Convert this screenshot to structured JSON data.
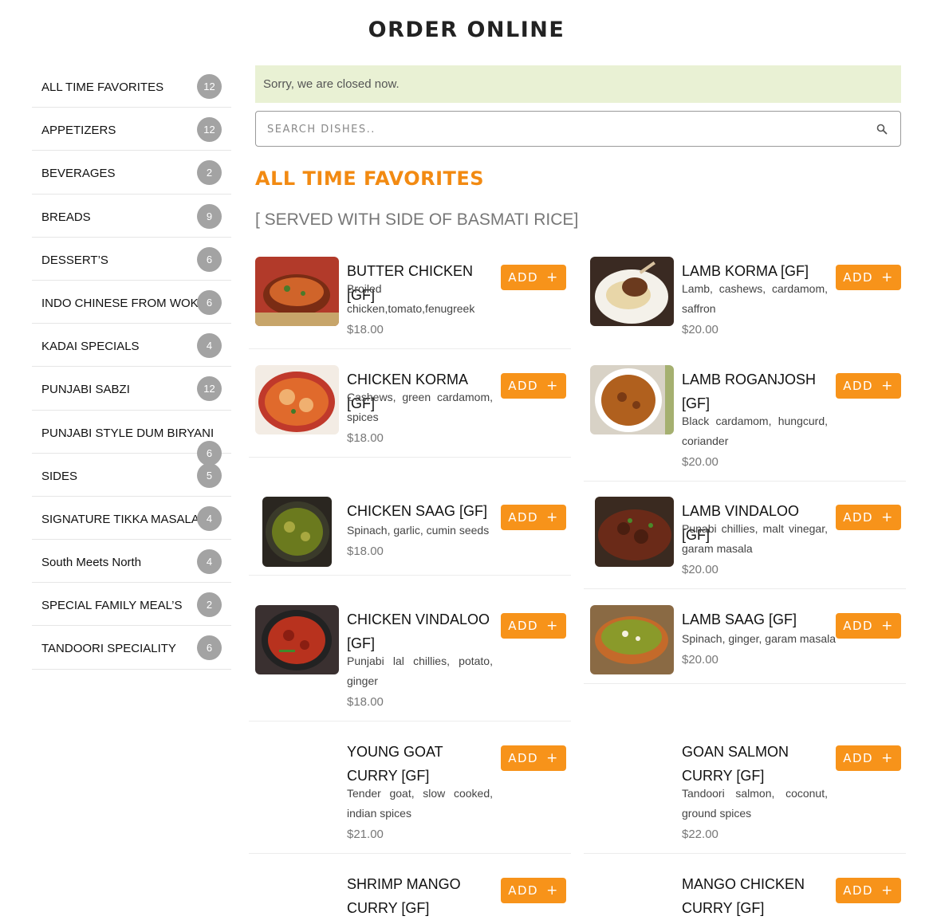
{
  "page": {
    "title": "ORDER ONLINE"
  },
  "categories": [
    {
      "label": "ALL TIME FAVORITES",
      "count": "12"
    },
    {
      "label": "APPETIZERS",
      "count": "12"
    },
    {
      "label": "BEVERAGES",
      "count": "2"
    },
    {
      "label": "BREADS",
      "count": "9"
    },
    {
      "label": "DESSERT’S",
      "count": "6"
    },
    {
      "label": "INDO CHINESE FROM WOK",
      "count": "6"
    },
    {
      "label": "KADAI SPECIALS",
      "count": "4"
    },
    {
      "label": "PUNJABI SABZI",
      "count": "12"
    },
    {
      "label": "PUNJABI STYLE DUM BIRYANI",
      "count": "6"
    },
    {
      "label": "SIDES",
      "count": "5"
    },
    {
      "label": "SIGNATURE TIKKA MASALA",
      "count": "4"
    },
    {
      "label": "South Meets North",
      "count": "4"
    },
    {
      "label": "SPECIAL FAMILY MEAL’S",
      "count": "2"
    },
    {
      "label": "TANDOORI SPECIALITY",
      "count": "6"
    }
  ],
  "notice": "Sorry, we are closed now.",
  "search": {
    "placeholder": "SEARCH DISHES.."
  },
  "section": {
    "title": "ALL TIME FAVORITES",
    "subtitle": "[ SERVED WITH SIDE OF BASMATI RICE]"
  },
  "add_label": "ADD",
  "add_plus": "+",
  "dishes": [
    {
      "name": "BUTTER CHICKEN [GF]",
      "desc": "Broiled chicken,tomato,fenugreek",
      "price": "$18.00"
    },
    {
      "name": "LAMB KORMA [GF]",
      "desc": "Lamb, cashews, cardamom, saffron",
      "price": "$20.00"
    },
    {
      "name": "CHICKEN KORMA [GF]",
      "desc": "Cashews, green cardamom, spices",
      "price": "$18.00"
    },
    {
      "name": "LAMB ROGANJOSH [GF]",
      "desc": "Black cardamom, hungcurd, coriander",
      "price": "$20.00"
    },
    {
      "name": "CHICKEN SAAG [GF]",
      "desc": "Spinach, garlic, cumin seeds",
      "price": "$18.00"
    },
    {
      "name": "LAMB VINDALOO [GF]",
      "desc": "Punabi chillies, malt vinegar, garam masala",
      "price": "$20.00"
    },
    {
      "name": "CHICKEN VINDALOO [GF]",
      "desc": "Punjabi lal chillies, potato, ginger",
      "price": "$18.00"
    },
    {
      "name": "LAMB SAAG [GF]",
      "desc": "Spinach, ginger, garam masala",
      "price": "$20.00"
    },
    {
      "name": "YOUNG GOAT CURRY [GF]",
      "desc": "Tender goat, slow cooked, indian spices",
      "price": "$21.00"
    },
    {
      "name": "GOAN SALMON CURRY [GF]",
      "desc": "Tandoori salmon, coconut, ground spices",
      "price": "$22.00"
    },
    {
      "name": "SHRIMP MANGO CURRY [GF]",
      "desc": "",
      "price": ""
    },
    {
      "name": "MANGO CHICKEN CURRY [GF]",
      "desc": "",
      "price": ""
    }
  ],
  "colors": {
    "accent": "#f7931a",
    "section_title": "#f28a12",
    "notice_bg": "#e9f1d4",
    "badge": "#a3a3a3"
  }
}
